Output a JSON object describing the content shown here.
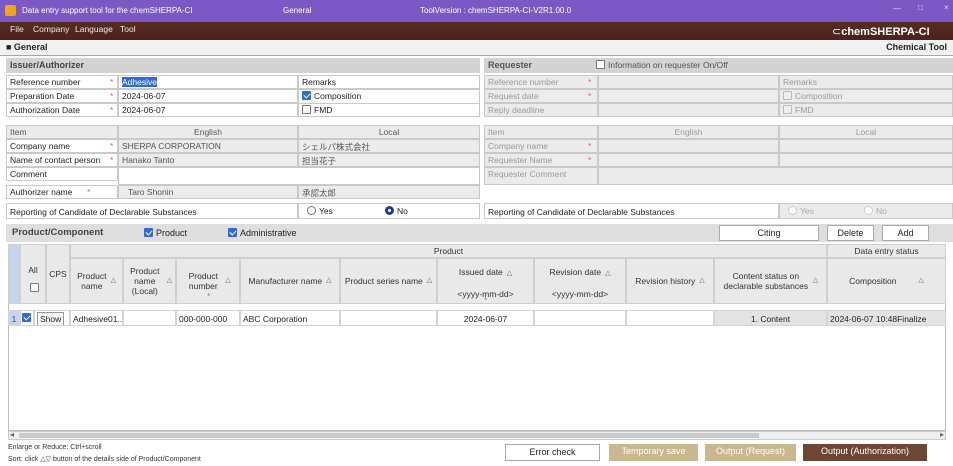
{
  "window": {
    "title": "Data entry support tool for the chemSHERPA-CI",
    "center": "General",
    "version": "ToolVersion : chemSHERPA-CI-V2R1.00.0",
    "min": "—",
    "max": "□",
    "close": "×"
  },
  "menu": [
    "File",
    "Company",
    "Language",
    "Tool"
  ],
  "brand": {
    "logo": "chemSHERPA-CI",
    "sub": "Chemical Tool"
  },
  "page": {
    "title": "■ General"
  },
  "issuer": {
    "header": "Issuer/Authorizer",
    "ref_label": "Reference number",
    "ref_value": "Adhesive",
    "prep_label": "Preparation Date",
    "prep_value": "2024-06-07",
    "auth_label": "Authorization Date",
    "auth_value": "2024-06-07",
    "remarks": "Remarks",
    "composition": "Composition",
    "fmd": "FMD",
    "item": "Item",
    "english": "English",
    "local": "Local",
    "company_label": "Company name",
    "company_en": "SHERPA CORPORATION",
    "company_local": "シェルパ株式会社",
    "contact_label": "Name of contact person",
    "contact_en": "Hanako Tanto",
    "contact_local": "担当花子",
    "comment_label": "Comment",
    "authorizer_label": "Authorizer name",
    "authorizer_en": "Taro Shonin",
    "authorizer_local": "承認太郎",
    "reporting": "Reporting of Candidate of Declarable Substances",
    "yes": "Yes",
    "no": "No"
  },
  "requester": {
    "header": "Requester",
    "toggle": "Information on requester On/Off",
    "ref_label": "Reference number",
    "date_label": "Request date",
    "deadline_label": "Reply deadline",
    "remarks": "Remarks",
    "composition": "Composition",
    "fmd": "FMD",
    "item": "Item",
    "english": "English",
    "local": "Local",
    "company_label": "Company name",
    "name_label": "Requester Name",
    "comment_label": "Requester Comment",
    "reporting": "Reporting of Candidate of Declarable Substances",
    "yes": "Yes",
    "no": "No"
  },
  "product_bar": {
    "header": "Product/Component",
    "product": "Product",
    "administrative": "Administrative",
    "citing": "Citing",
    "delete": "Delete",
    "add": "Add"
  },
  "grid": {
    "group_product": "Product",
    "group_status": "Data entry status",
    "all": "All",
    "cps": "CPS",
    "cols": [
      "Product name",
      "Product name (Local)",
      "Product number",
      "Manufacturer name",
      "Product series name",
      "Issued date",
      "Revision date",
      "Revision history",
      "Content status on declarable substances",
      "Composition"
    ],
    "date_hint": "<yyyy-mm-dd>",
    "row": {
      "num": "1",
      "show": "Show",
      "name": "Adhesive01...",
      "name_local": "",
      "number": "000-000-000",
      "manufacturer": "ABC Corporation",
      "series": "",
      "issued": "2024-06-07",
      "revised": "",
      "history": "",
      "content_status": "1. Content",
      "composition": "2024-06-07 10:48Finalize"
    }
  },
  "footer": {
    "hint1": "Enlarge or Reduce: Ctrl+scroll",
    "hint2": "Sort: click △▽ button of the details side of Product/Component",
    "error_check": "Error check",
    "temp_save": "Temporary save",
    "out_req": "Output (Request)",
    "out_auth": "Output (Authorization)"
  },
  "colors": {
    "titlebar": "#7b58c4",
    "menubar": "#4a231c",
    "accent": "#2e6cd3"
  }
}
